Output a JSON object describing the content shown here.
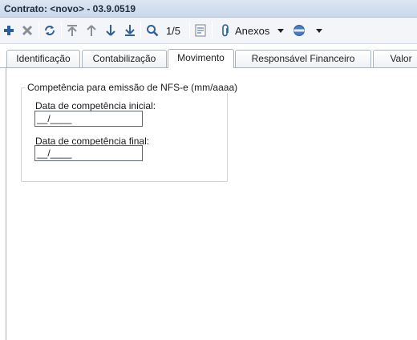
{
  "window": {
    "title": "Contrato: <novo> - 03.9.0519"
  },
  "toolbar": {
    "record_position": "1/5",
    "attachments_label": "Anexos",
    "icons": [
      "add-icon",
      "delete-icon",
      "refresh-icon",
      "first-record-icon",
      "previous-record-icon",
      "next-record-icon",
      "last-record-icon",
      "search-icon",
      "spellcheck-icon",
      "paperclip-icon",
      "caret-down-icon",
      "globe-icon",
      "caret-down-icon"
    ]
  },
  "tabs": [
    {
      "label": "Identificação"
    },
    {
      "label": "Contabilização"
    },
    {
      "label": "Movimento",
      "active": true
    },
    {
      "label": "Responsável Financeiro"
    },
    {
      "label": "Valor"
    }
  ],
  "competencia": {
    "legend": "Competência para emissão de NFS-e  (mm/aaaa)",
    "start_label": "Data de competência inicial:",
    "start_value": "__/____",
    "end_label": "Data de competência final:",
    "end_value": "__/____"
  },
  "colors": {
    "titlebar": "#c9d8ec",
    "icon_blue": "#2b5f9e",
    "icon_gray": "#8a8f96"
  }
}
